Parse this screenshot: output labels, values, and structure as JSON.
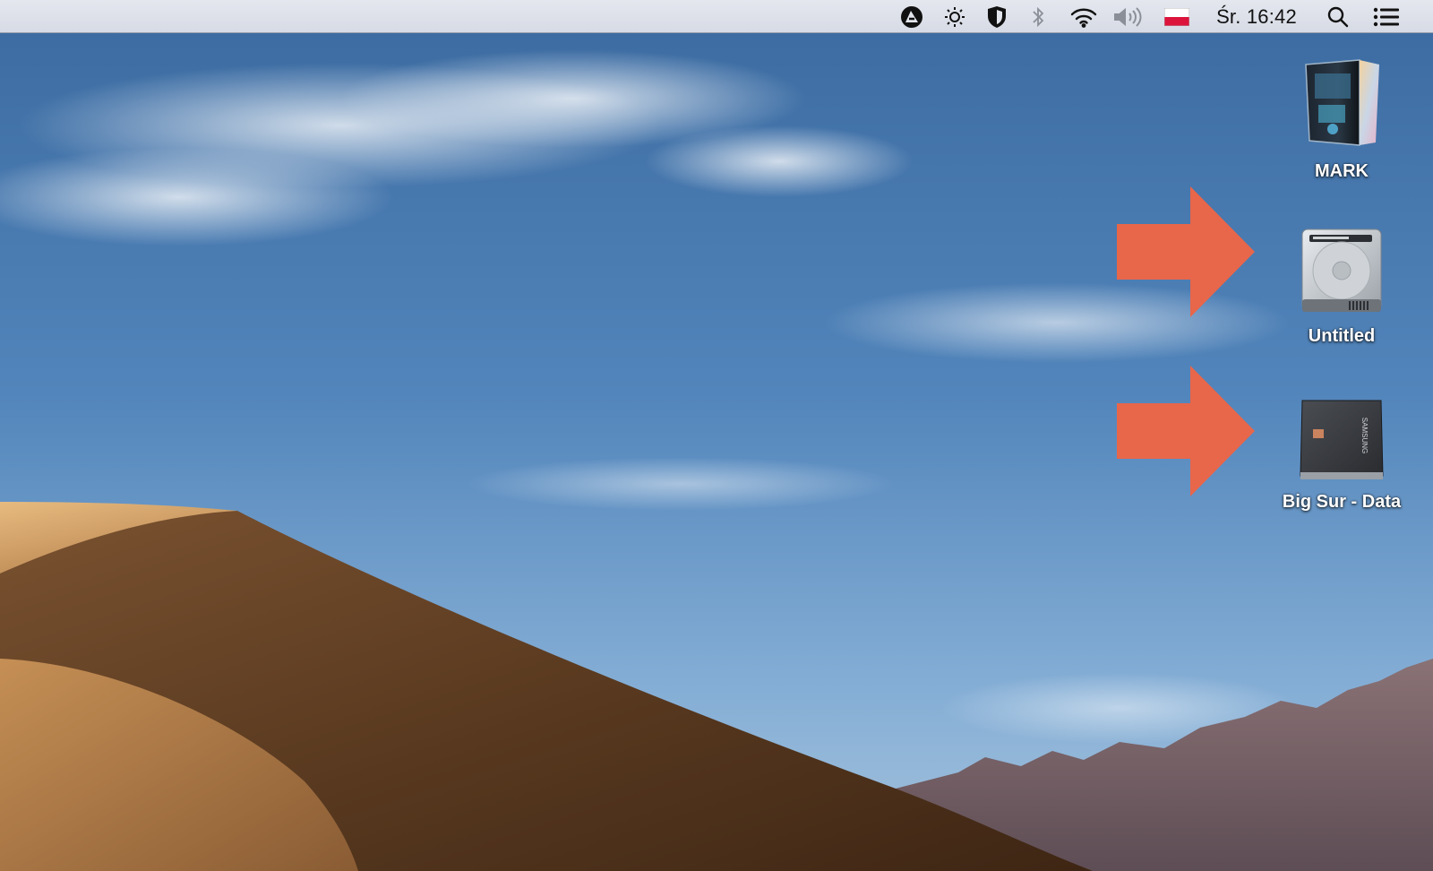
{
  "menubar": {
    "status_icons": [
      "adblock-icon",
      "brightness-icon",
      "shield-icon",
      "bluetooth-icon",
      "wifi-icon",
      "volume-icon",
      "poland-flag-icon"
    ],
    "clock": "Śr. 16:42",
    "right_icons": [
      "spotlight-search-icon",
      "notification-center-icon"
    ]
  },
  "desktop": {
    "icons": [
      {
        "label": "MARK",
        "icon": "computer-case-icon"
      },
      {
        "label": "Untitled",
        "icon": "hard-drive-icon"
      },
      {
        "label": "Big Sur - Data",
        "icon": "ssd-drive-icon"
      }
    ],
    "annotations": {
      "arrow_color": "#e8664a"
    }
  },
  "wallpaper": {
    "description_colors": {
      "sky": "#4b7db3",
      "dune": "#6b4526",
      "mountains": "#6d5a5e"
    }
  }
}
